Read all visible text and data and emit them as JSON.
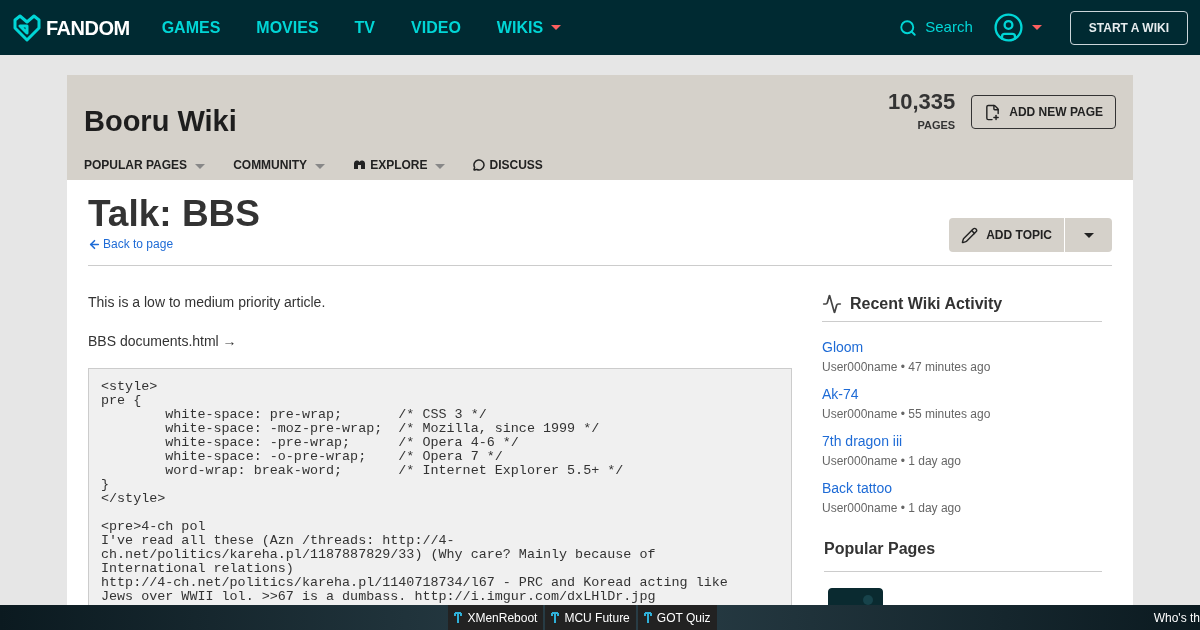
{
  "topnav": {
    "logo": "FANDOM",
    "links": [
      {
        "label": "GAMES",
        "dropdown": false
      },
      {
        "label": "MOVIES",
        "dropdown": false
      },
      {
        "label": "TV",
        "dropdown": false
      },
      {
        "label": "VIDEO",
        "dropdown": false
      },
      {
        "label": "WIKIS",
        "dropdown": true
      }
    ],
    "search": "Search",
    "start_button": "START A WIKI"
  },
  "wiki": {
    "title": "Booru Wiki",
    "page_count": "10,335",
    "page_count_label": "PAGES",
    "add_page": "ADD NEW PAGE",
    "nav": [
      {
        "label": "POPULAR PAGES",
        "kind": "dropdown"
      },
      {
        "label": "COMMUNITY",
        "kind": "dropdown"
      },
      {
        "label": "EXPLORE",
        "kind": "explore"
      },
      {
        "label": "DISCUSS",
        "kind": "discuss"
      }
    ]
  },
  "page": {
    "title": "Talk: BBS",
    "back_link": "Back to page",
    "add_topic": "ADD TOPIC",
    "intro": "This is a low to medium priority article.",
    "doc_link": "BBS documents.html →",
    "code_blocks": [
      [
        "<style>",
        "pre {",
        "        white-space: pre-wrap;       /* CSS 3 */",
        "        white-space: -moz-pre-wrap;  /* Mozilla, since 1999 */",
        "        white-space: -pre-wrap;      /* Opera 4-6 */",
        "        white-space: -o-pre-wrap;    /* Opera 7 */",
        "        word-wrap: break-word;       /* Internet Explorer 5.5+ */",
        "}",
        "</style>"
      ],
      [
        "<pre>4-ch pol",
        "I've read all these (Azn /threads: http://4-",
        "ch.net/politics/kareha.pl/1187887829/33) (Why care? Mainly because of",
        "International relations)",
        "http://4-ch.net/politics/kareha.pl/1140718734/l67 - PRC and Koread acting like",
        "Jews over WWII lol. >>67 is a dumbass. http://i.imgur.com/dxLHlDr.jpg"
      ]
    ]
  },
  "sidebar": {
    "activity_title": "Recent Wiki Activity",
    "activity": [
      {
        "page": "Gloom",
        "meta": "User000name • 47 minutes ago"
      },
      {
        "page": "Ak-74",
        "meta": "User000name • 55 minutes ago"
      },
      {
        "page": "7th dragon iii",
        "meta": "User000name • 1 day ago"
      },
      {
        "page": "Back tattoo",
        "meta": "User000name • 1 day ago"
      }
    ],
    "popular_title": "Popular Pages"
  },
  "bottom_bar": {
    "items": [
      "XMenReboot",
      "MCU Future",
      "GOT Quiz"
    ],
    "right_text": "Who's th"
  }
}
